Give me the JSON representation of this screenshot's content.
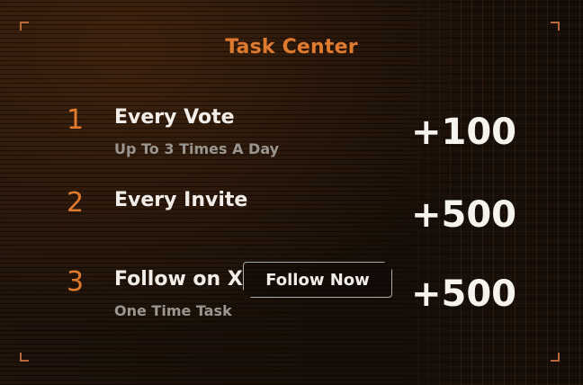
{
  "panel": {
    "title": "Task Center",
    "accent_color": "#e07a2e",
    "tasks": [
      {
        "number": "1",
        "name": "Every Vote",
        "subtitle": "Up To 3 Times A Day",
        "reward": "+100"
      },
      {
        "number": "2",
        "name": "Every Invite",
        "reward": "+500"
      },
      {
        "number": "3",
        "name": "Follow on X",
        "subtitle": "One Time Task",
        "reward": "+500",
        "button_label": "Follow Now"
      }
    ]
  }
}
